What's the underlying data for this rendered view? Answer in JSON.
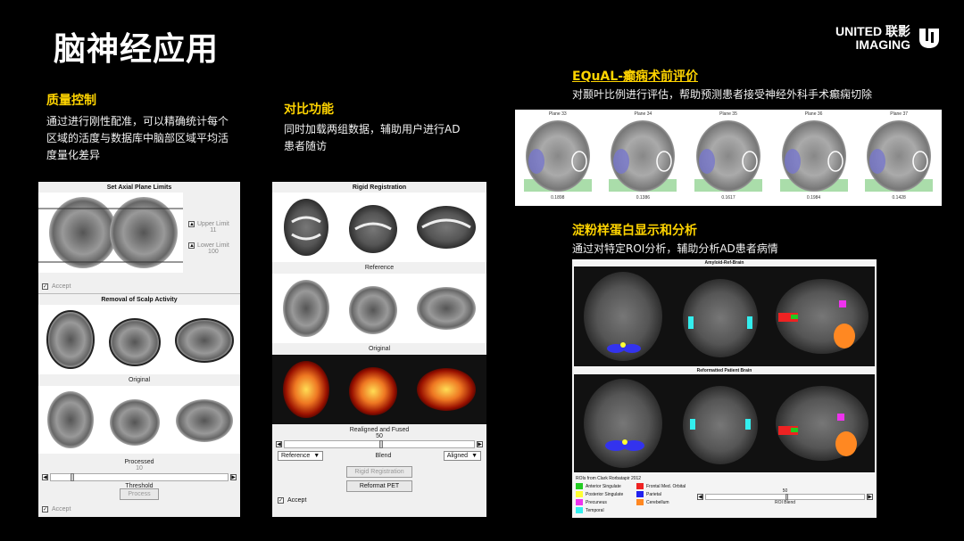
{
  "page": {
    "title": "脑神经应用"
  },
  "brand": {
    "line1": "UNITED 联影",
    "line2": "IMAGING"
  },
  "sections": {
    "quality": {
      "title": "质量控制",
      "desc1": "通过进行刚性配准，可以精确统计每个",
      "desc2": "区域的活度与数据库中脑部区域平均活",
      "desc3": "度量化差异"
    },
    "compare": {
      "title": "对比功能",
      "desc1": "同时加载两组数据，辅助用户进行AD",
      "desc2": "患者随访"
    },
    "equal": {
      "title": "EQuAL-癫痫术前评价",
      "desc": "对颞叶比例进行评估，帮助预测患者接受神经外科手术癫痫切除"
    },
    "amyloid": {
      "title": "淀粉样蛋白显示和分析",
      "desc": "通过对特定ROI分析，辅助分析AD患者病情"
    }
  },
  "panel1": {
    "header": "Set Axial Plane Limits",
    "upper_label": "Upper Limit",
    "upper_value": "11",
    "lower_label": "Lower Limit",
    "lower_value": "100",
    "accept1": "Accept",
    "scalp_header": "Removal of Scalp Activity",
    "cap_original": "Original",
    "cap_processed": "Processed",
    "processed_value": "10",
    "threshold": "Threshold",
    "process_btn": "Process",
    "accept2": "Accept"
  },
  "panel2": {
    "header": "Rigid Registration",
    "cap_reference": "Reference",
    "cap_original": "Original",
    "cap_fused": "Realigned and Fused",
    "slider_value": "50",
    "ref_select": "Reference",
    "blend": "Blend",
    "aligned_select": "Aligned",
    "rigid_btn": "Rigid Registration",
    "reformat_btn": "Reformat PET",
    "accept": "Accept"
  },
  "panel3": {
    "planes": [
      {
        "label": "Plane 33",
        "value": "0.1898"
      },
      {
        "label": "Plane 34",
        "value": "0.1386"
      },
      {
        "label": "Plane 35",
        "value": "0.1617"
      },
      {
        "label": "Plane 36",
        "value": "0.1984"
      },
      {
        "label": "Plane 37",
        "value": "0.1428"
      }
    ]
  },
  "panel4": {
    "header_top": "Amyloid-Ref-Brain",
    "header_mid": "Reformatted Patient Brain",
    "roi_title": "ROIs from Clark Rorbatapir 2012",
    "rois": [
      {
        "name": "Anterior Singulate",
        "color": "#22cc22"
      },
      {
        "name": "Frontal Med. Orbital",
        "color": "#ee2222"
      },
      {
        "name": "Posterior Singulate",
        "color": "#ffff33"
      },
      {
        "name": "Parietal",
        "color": "#2222ee"
      },
      {
        "name": "Precuneus",
        "color": "#ee33ee"
      },
      {
        "name": "Cerebellum",
        "color": "#ff8822"
      },
      {
        "name": "Temporal",
        "color": "#33eeee"
      }
    ],
    "blend_value": "50",
    "blend_label": "ROI Blend"
  }
}
